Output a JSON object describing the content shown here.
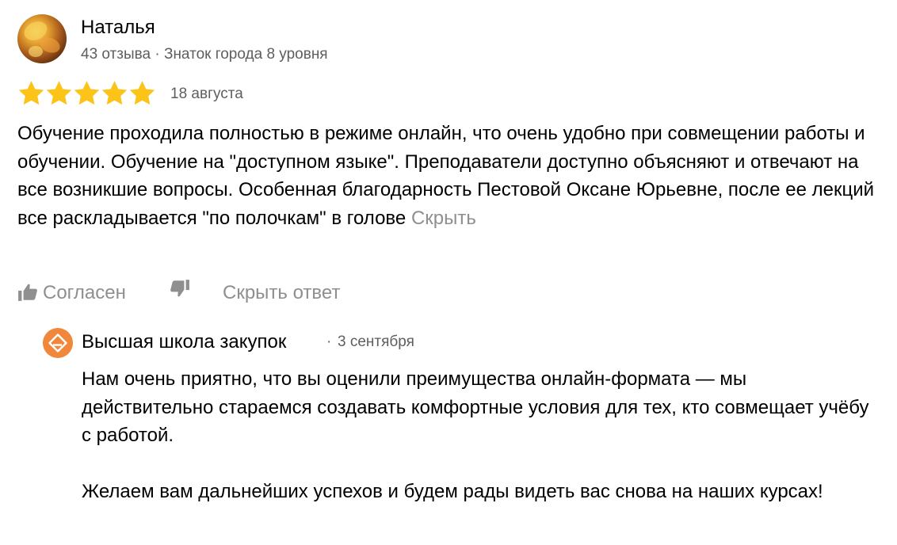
{
  "review": {
    "author": {
      "name": "Наталья",
      "meta": "43 отзыва · Знаток города 8 уровня"
    },
    "rating": {
      "value": 5,
      "max": 5,
      "star_color": "#fcc419"
    },
    "date": "18 августа",
    "text": "Обучение проходила полностью в режиме онлайн, что очень удобно при совмещении работы и обучении. Обучение на \"доступном языке\". Преподаватели доступно объясняют и отвечают на все возникшие вопросы. Особенная благодарность Пестовой Оксане Юрьевне, после ее лекций все раскладывается \"по полочкам\" в голове",
    "collapse_link": "Скрыть"
  },
  "actions": {
    "agree_label": "Согласен",
    "like_icon": "thumbs-up-icon",
    "dislike_icon": "thumbs-down-icon",
    "hide_answer_label": "Скрыть ответ"
  },
  "reply": {
    "org_name": "Высшая школа закупок",
    "separator": "·",
    "date": "3 сентября",
    "logo_color": "#f0873a",
    "paragraphs": [
      "Нам очень приятно, что вы оценили преимущества онлайн-формата — мы действительно стараемся создавать комфортные условия для тех, кто совмещает учёбу с работой.",
      "Желаем вам дальнейших успехов и будем рады видеть вас снова на наших курсах!"
    ]
  },
  "colors": {
    "text": "#000000",
    "secondary_text": "#5e5e5e",
    "muted_link": "#8f8f8f"
  }
}
